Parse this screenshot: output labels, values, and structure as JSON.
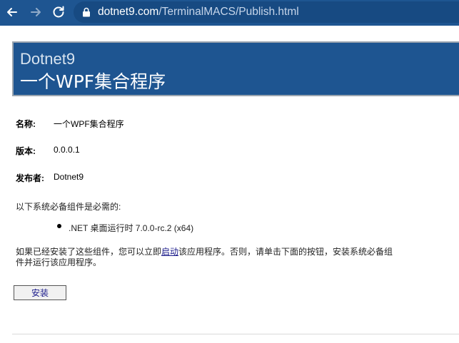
{
  "browser": {
    "url_domain": "dotnet9.com",
    "url_path": "/TerminalMACS/Publish.html",
    "back_icon": "arrow-left-icon",
    "forward_icon": "arrow-right-icon",
    "reload_icon": "reload-icon",
    "lock_icon": "lock-icon"
  },
  "header": {
    "title1": "Dotnet9",
    "title2": "一个WPF集合程序"
  },
  "info": {
    "name_label": "名称:",
    "name_value": "一个WPF集合程序",
    "version_label": "版本:",
    "version_value": "0.0.0.1",
    "publisher_label": "发布者:",
    "publisher_value": "Dotnet9"
  },
  "prereq": {
    "intro": "以下系统必备组件是必需的:",
    "items": [
      ".NET 桌面运行时 7.0.0-rc.2 (x64)"
    ]
  },
  "instructions": {
    "part1": "如果已经安装了这些组件，您可以立即",
    "link": "启动",
    "part2": "该应用程序。否则，请单击下面的按钮，安装系统必备组",
    "line2": "件并运行该应用程序。"
  },
  "install_button": "安装",
  "colors": {
    "toolbar": "#1e5591",
    "header": "#1e5591"
  }
}
